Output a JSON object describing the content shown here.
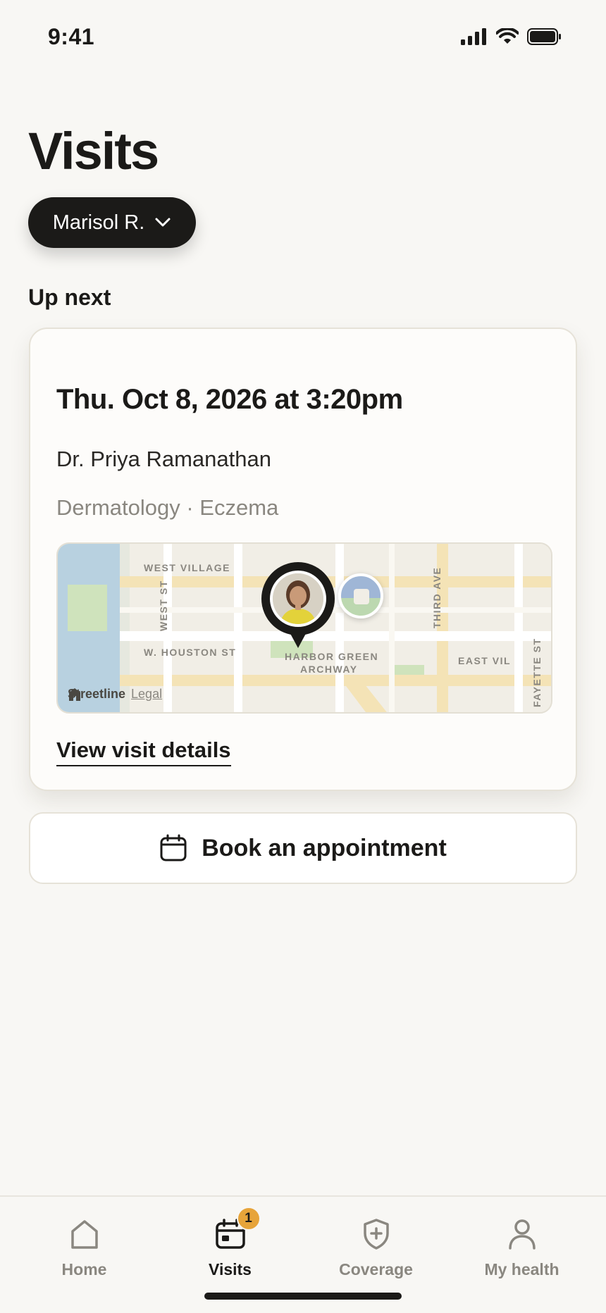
{
  "status_bar": {
    "time": "9:41"
  },
  "header": {
    "title": "Visits"
  },
  "person_selector": {
    "name": "Marisol R."
  },
  "up_next": {
    "section_label": "Up next",
    "datetime": "Thu. Oct 8, 2026 at 3:20pm",
    "doctor": "Dr. Priya Ramanathan",
    "specialty": "Dermatology · Eczema",
    "map": {
      "labels": {
        "west_village": "WEST VILLAGE",
        "west_st": "WEST ST",
        "houston": "W. HOUSTON ST",
        "harbor_line1": "HARBOR GREEN",
        "harbor_line2": "ARCHWAY",
        "third_ave": "THIRD AVE",
        "east_vil": "EAST VIL",
        "fayette": "FAYETTE ST"
      },
      "attribution": {
        "brand": "Streetline",
        "legal": "Legal"
      }
    },
    "details_link": "View visit details"
  },
  "book_button": {
    "label": "Book an appointment"
  },
  "tab_bar": {
    "tabs": [
      {
        "label": "Home",
        "icon": "home-icon"
      },
      {
        "label": "Visits",
        "icon": "calendar-icon",
        "badge": "1",
        "active": true
      },
      {
        "label": "Coverage",
        "icon": "shield-plus-icon"
      },
      {
        "label": "My health",
        "icon": "person-icon"
      }
    ]
  },
  "colors": {
    "accent_dark": "#1b1a18",
    "badge": "#e7a43a",
    "background": "#f8f7f4"
  }
}
